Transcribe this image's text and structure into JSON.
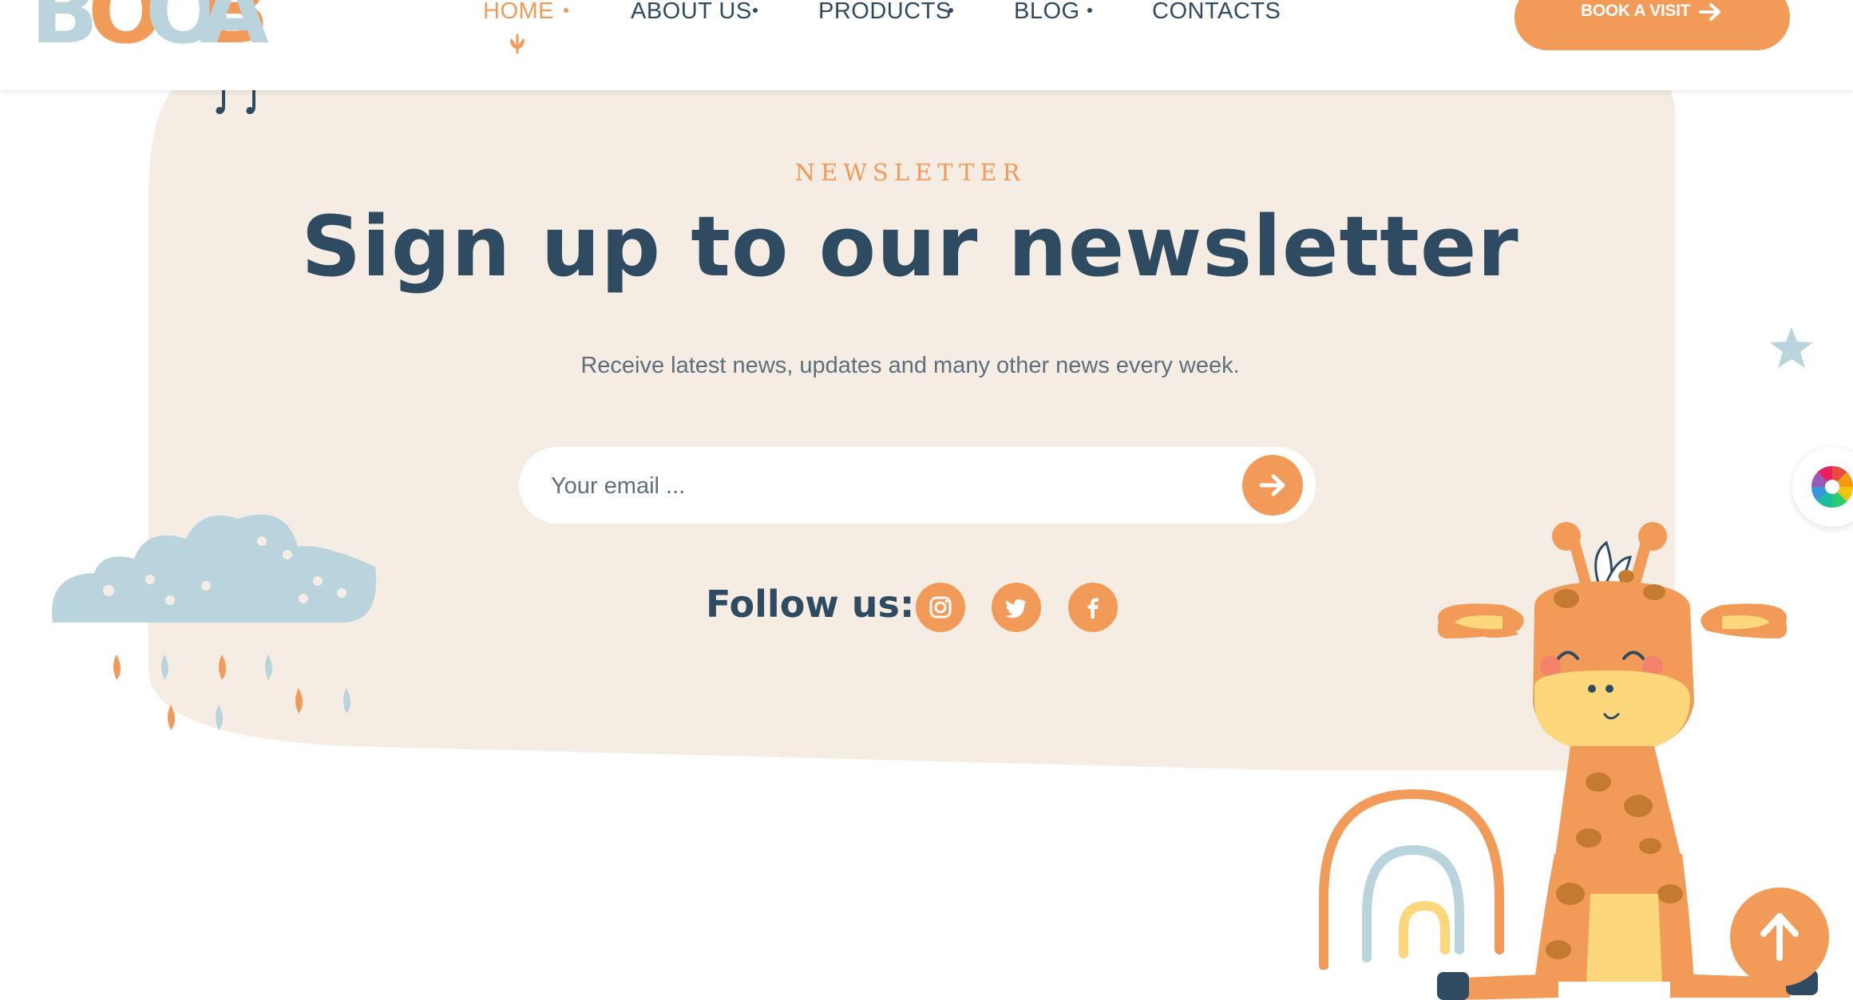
{
  "brand": {
    "logo_text": "BOOBA",
    "colors": {
      "orange": "#f29a57",
      "navy": "#2e4b62",
      "light_blue": "#b9d4dc",
      "cream": "#f5ede3"
    }
  },
  "nav": {
    "items": [
      {
        "label": "HOME",
        "active": true
      },
      {
        "label": "ABOUT US",
        "active": false
      },
      {
        "label": "PRODUCTS",
        "active": false
      },
      {
        "label": "BLOG",
        "active": false
      },
      {
        "label": "CONTACTS",
        "active": false
      }
    ],
    "cta_label": "BOOK A VISIT"
  },
  "newsletter": {
    "kicker": "NEWSLETTER",
    "headline": "Sign up to our newsletter",
    "subtitle": "Receive latest news, updates and many other news every week.",
    "email_placeholder": "Your email ...",
    "follow_label": "Follow us:",
    "socials": [
      "instagram-icon",
      "twitter-icon",
      "facebook-icon"
    ]
  },
  "icons": {
    "cta": "arrow-right-icon",
    "submit": "arrow-right-icon",
    "scroll_top": "arrow-up-icon",
    "side_tab": "color-wheel-icon",
    "nav_active": "leaf-icon"
  }
}
